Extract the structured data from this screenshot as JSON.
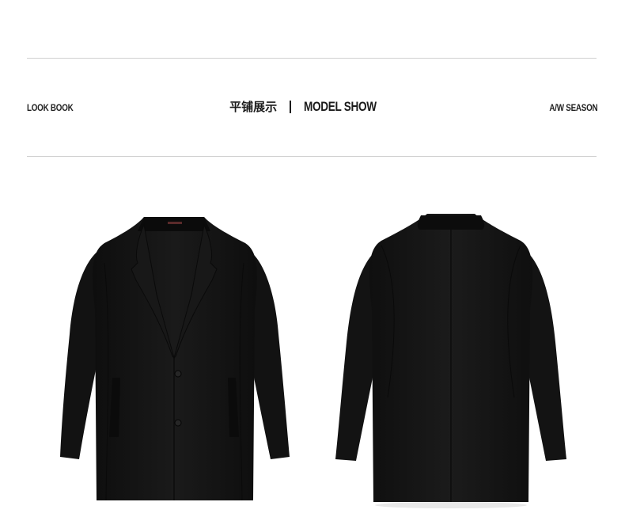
{
  "header": {
    "left_label": "LOOK BOOK",
    "title_cn": "平铺展示",
    "title_en": "MODEL SHOW",
    "right_label": "A/W SEASON"
  },
  "products": [
    {
      "view": "front",
      "icon": "coat-front-image"
    },
    {
      "view": "back",
      "icon": "coat-back-image"
    }
  ],
  "colors": {
    "coat": "#141414",
    "rule": "#cfcfcf",
    "text": "#1b1b1b"
  }
}
